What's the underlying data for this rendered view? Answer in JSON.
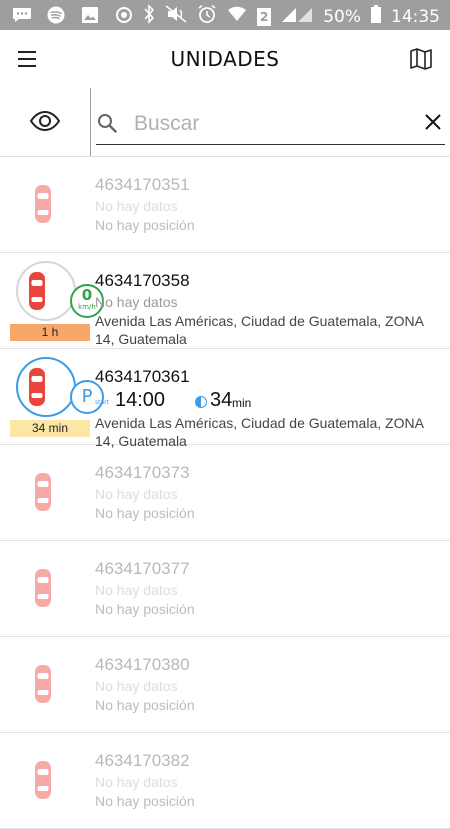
{
  "statusbar": {
    "battery_text": "50%",
    "time": "14:35",
    "sim_label": "2"
  },
  "appbar": {
    "title": "UNIDADES"
  },
  "search": {
    "placeholder": "Buscar",
    "value": ""
  },
  "units": [
    {
      "id": "4634170351",
      "status": "offline",
      "line2": "No hay datos",
      "line3": "No hay posición"
    },
    {
      "id": "4634170358",
      "status": "moving",
      "speed": "0",
      "speed_unit": "km/h",
      "tag": "1 h",
      "line2": "No hay datos",
      "line3": "Avenida Las Américas, Ciudad de Guatemala, ZONA 14, Guatemala"
    },
    {
      "id": "4634170361",
      "status": "parked",
      "park_symbol": "P",
      "tag": "34 min",
      "start_label": "start",
      "start_time": "14:00",
      "duration": "34",
      "duration_unit": "min",
      "line3": "Avenida Las Américas, Ciudad de Guatemala, ZONA 14, Guatemala"
    },
    {
      "id": "4634170373",
      "status": "offline",
      "line2": "No hay datos",
      "line3": "No hay posición"
    },
    {
      "id": "4634170377",
      "status": "offline",
      "line2": "No hay datos",
      "line3": "No hay posición"
    },
    {
      "id": "4634170380",
      "status": "offline",
      "line2": "No hay datos",
      "line3": "No hay posición"
    },
    {
      "id": "4634170382",
      "status": "offline",
      "line2": "No hay datos",
      "line3": "No hay posición"
    }
  ],
  "colors": {
    "accent_blue": "#3d9be8",
    "speed_green": "#2ea34a",
    "tag_orange": "#f8a76a",
    "tag_yellow": "#fbe6a6",
    "car_red": "#e8453c"
  }
}
